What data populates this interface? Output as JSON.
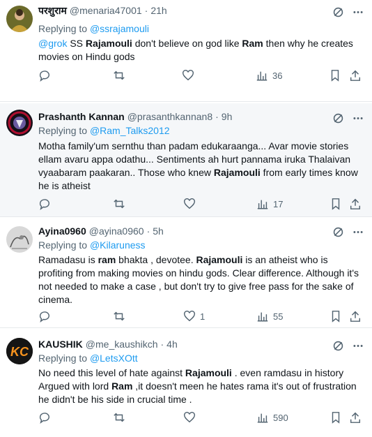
{
  "tweets": [
    {
      "name": "परशुराम",
      "handle": "@menaria47001",
      "time": "21h",
      "replying_prefix": "Replying to ",
      "replying_to": "@ssrajamouli",
      "text_parts": [
        "@grok",
        " SS ",
        "Rajamouli",
        " don't believe on god like ",
        "Ram",
        " then why he creates movies on Hindu gods"
      ],
      "reply_count": "",
      "retweet_count": "",
      "like_count": "",
      "views": "36"
    },
    {
      "name": "Prashanth Kannan",
      "handle": "@prasanthkannan8",
      "time": "9h",
      "replying_prefix": "Replying to ",
      "replying_to": "@Ram_Talks2012",
      "text_parts": [
        "Motha family'um sernthu than padam edukaraanga... Avar movie stories ellam avaru appa odathu... Sentiments ah hurt pannama iruka Thalaivan vyaabaram paakaran.. Those who knew ",
        "Rajamouli",
        " from early times know he is atheist"
      ],
      "reply_count": "",
      "retweet_count": "",
      "like_count": "",
      "views": "17"
    },
    {
      "name": "Ayina0960",
      "handle": "@ayina0960",
      "time": "5h",
      "replying_prefix": "Replying to ",
      "replying_to": "@Kilaruness",
      "text_parts": [
        "Ramadasu is ",
        "ram",
        " bhakta , devotee. ",
        "Rajamouli",
        " is an atheist who is profiting from making movies on hindu gods. Clear difference. Although it's not needed to make a case , but don't try to give free pass for the sake of cinema."
      ],
      "reply_count": "",
      "retweet_count": "",
      "like_count": "1",
      "views": "55"
    },
    {
      "name": "KAUSHIK",
      "handle": "@me_kaushikch",
      "time": "4h",
      "replying_prefix": "Replying to ",
      "replying_to": "@LetsXOtt",
      "text_parts": [
        "No need this level of hate against ",
        "Rajamouli",
        " . even ramdasu in history Argued with  lord ",
        "Ram",
        " ,it doesn't meen he hates rama it's out of frustration he didn't be his side in crucial time ."
      ],
      "reply_count": "",
      "retweet_count": "",
      "like_count": "",
      "views": "590"
    }
  ],
  "avatar_text": "KC",
  "separator": "·",
  "colors": {
    "link": "#1d9bf0",
    "muted": "#536471",
    "text": "#0f1419",
    "shaded_bg": "#f5f7f9",
    "kc_orange": "#f7931e"
  },
  "icons": [
    "grok-icon",
    "more-icon",
    "reply-icon",
    "retweet-icon",
    "like-icon",
    "views-icon",
    "bookmark-icon",
    "share-icon"
  ]
}
